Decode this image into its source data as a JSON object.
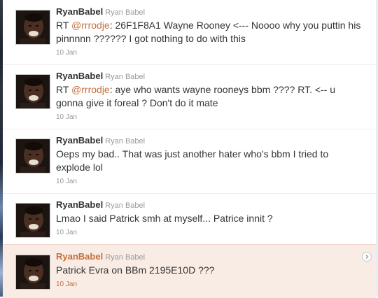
{
  "timeline": {
    "tweets": [
      {
        "screen_name": "RyanBabel",
        "full_name": "Ryan Babel",
        "text_prefix": "RT ",
        "mention": "@rrrodje",
        "text_body": ": 26F1F8A1 Wayne Rooney <--- Noooo why you puttin his pinnnnn ?????? I got nothing to do with this",
        "time": "10 Jan"
      },
      {
        "screen_name": "RyanBabel",
        "full_name": "Ryan Babel",
        "text_prefix": "RT ",
        "mention": "@rrrodje",
        "text_body": ": aye who wants wayne rooneys bbm ???? RT. <-- u gonna give it foreal ? Don't do it mate",
        "time": "10 Jan"
      },
      {
        "screen_name": "RyanBabel",
        "full_name": "Ryan Babel",
        "text": "Oeps my bad.. That was just another hater who's bbm I tried to explode lol",
        "time": "10 Jan"
      },
      {
        "screen_name": "RyanBabel",
        "full_name": "Ryan Babel",
        "text": "Lmao I said Patrick smh at myself... Patrice innit ?",
        "time": "10 Jan"
      },
      {
        "screen_name": "RyanBabel",
        "full_name": "Ryan Babel",
        "text": "Patrick Evra on BBm 2195E10D ???",
        "time": "10 Jan",
        "expand_icon": "chevron-right-icon"
      }
    ]
  },
  "colors": {
    "accent_link": "#c4703d",
    "highlight_background": "#f9ece4",
    "text": "#333333",
    "muted": "#999999"
  }
}
